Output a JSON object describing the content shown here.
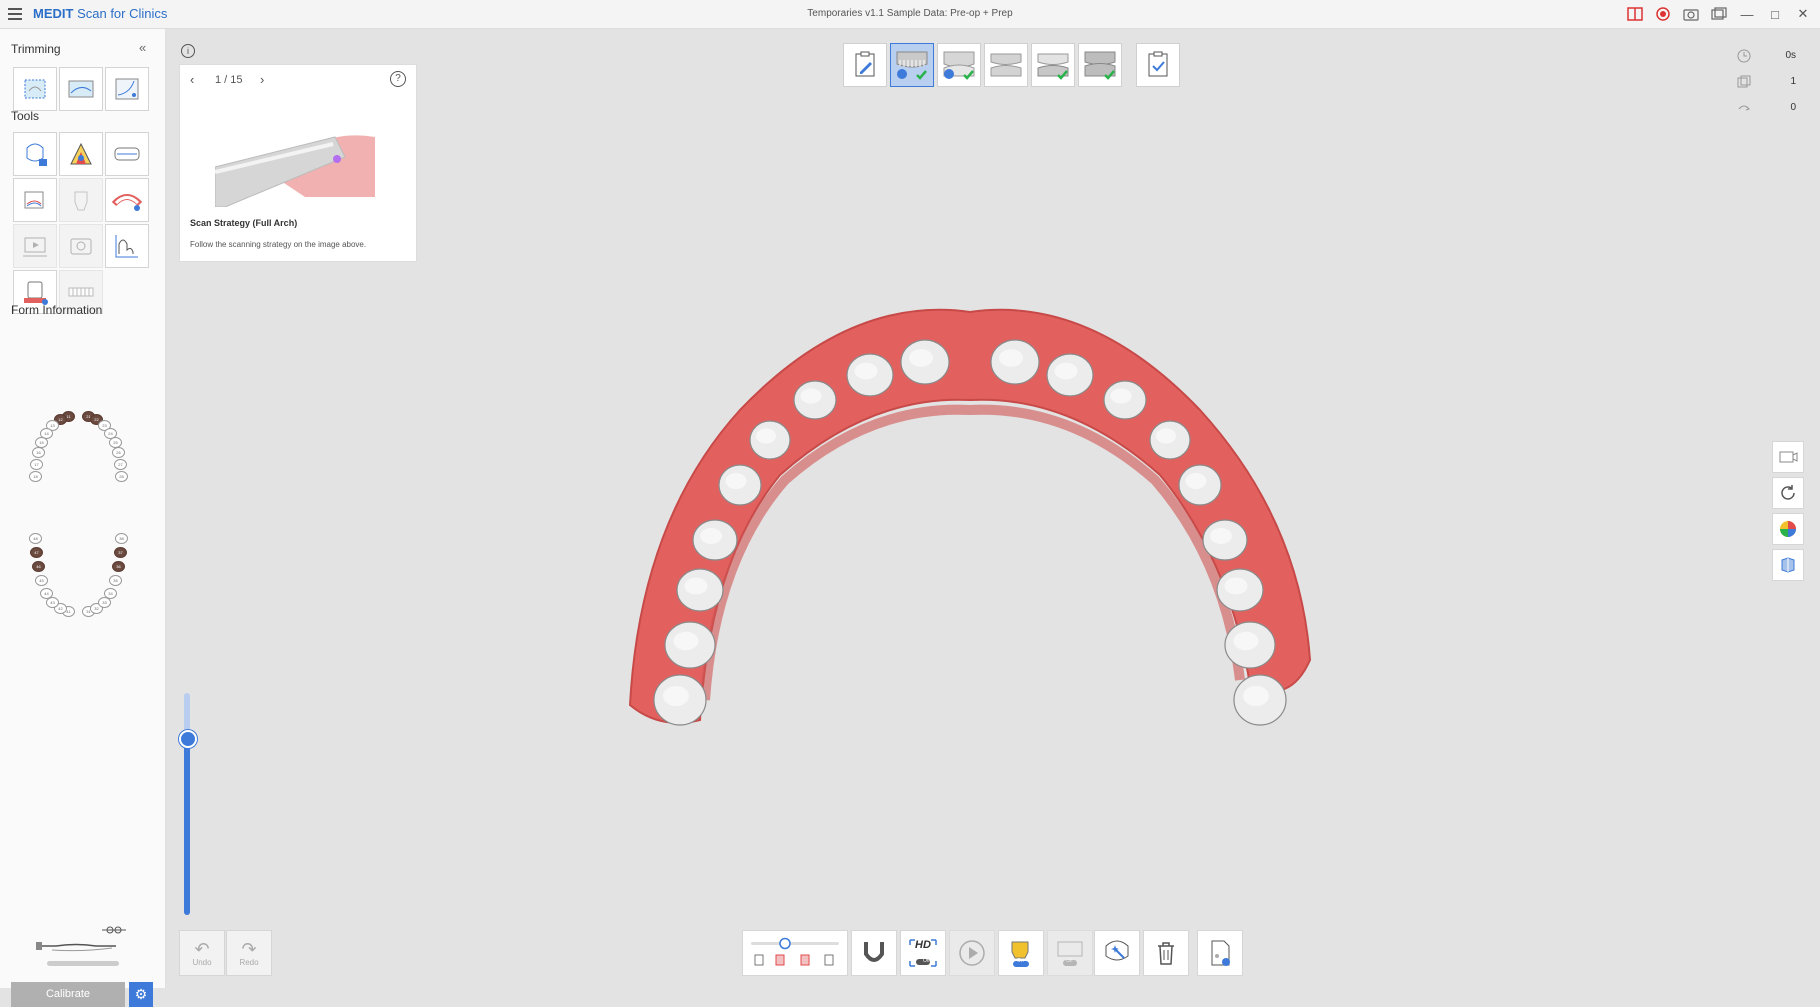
{
  "app": {
    "brand": "MEDIT",
    "name": "Scan for Clinics",
    "document_title": "Temporaries v1.1 Sample Data: Pre-op + Prep"
  },
  "sidebar": {
    "trimming_title": "Trimming",
    "tools_title": "Tools",
    "form_info_title": "Form Information",
    "calibrate_label": "Calibrate"
  },
  "guide": {
    "page": "1 / 15",
    "title": "Scan Strategy (Full Arch)",
    "description": "Follow the scanning strategy on the image above."
  },
  "stats": {
    "time": "0s",
    "count": "1",
    "rotation": "0"
  },
  "history": {
    "undo_label": "Undo",
    "redo_label": "Redo"
  },
  "bottom_toolbar": {
    "hd_label": "HD",
    "hd_state": "Off",
    "ai_state": "On",
    "filter_state": "Off"
  },
  "teeth": {
    "upper": [
      "11",
      "12",
      "13",
      "14",
      "15",
      "16",
      "17",
      "18",
      "21",
      "22",
      "23",
      "24",
      "25",
      "26",
      "27",
      "28"
    ],
    "lower": [
      "31",
      "32",
      "33",
      "34",
      "35",
      "36",
      "37",
      "38",
      "41",
      "42",
      "43",
      "44",
      "45",
      "46",
      "47",
      "48"
    ],
    "selected": [
      "11",
      "12",
      "21",
      "22",
      "36",
      "37",
      "46",
      "47"
    ]
  },
  "colors": {
    "accent": "#3d7ad9",
    "gum": "#e2615f",
    "tooth": "#ececec",
    "selected_tooth": "#6b4a3f"
  }
}
